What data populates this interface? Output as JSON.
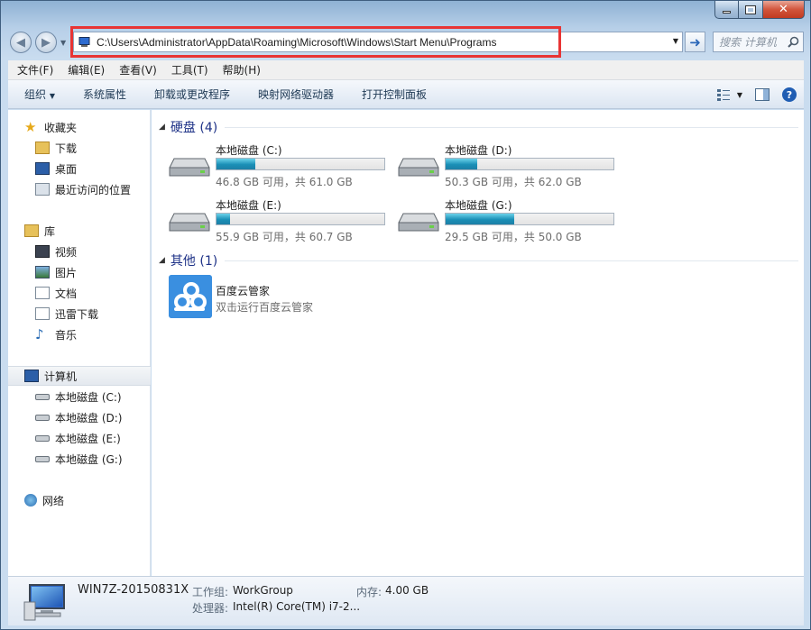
{
  "window": {
    "address_path": "C:\\Users\\Administrator\\AppData\\Roaming\\Microsoft\\Windows\\Start Menu\\Programs",
    "search_placeholder": "搜索 计算机"
  },
  "menu": [
    "文件(F)",
    "编辑(E)",
    "查看(V)",
    "工具(T)",
    "帮助(H)"
  ],
  "commands": [
    "组织",
    "系统属性",
    "卸载或更改程序",
    "映射网络驱动器",
    "打开控制面板"
  ],
  "sidebar": {
    "favorites": {
      "label": "收藏夹",
      "items": [
        "下载",
        "桌面",
        "最近访问的位置"
      ]
    },
    "libraries": {
      "label": "库",
      "items": [
        "视频",
        "图片",
        "文档",
        "迅雷下载",
        "音乐"
      ]
    },
    "computer": {
      "label": "计算机",
      "items": [
        "本地磁盘 (C:)",
        "本地磁盘 (D:)",
        "本地磁盘 (E:)",
        "本地磁盘 (G:)"
      ]
    },
    "network": {
      "label": "网络"
    }
  },
  "groups": {
    "drives_title": "硬盘 (4)",
    "other_title": "其他 (1)"
  },
  "drives": [
    {
      "name": "本地磁盘 (C:)",
      "info": "46.8 GB 可用，共 61.0 GB",
      "used_fraction": 0.233
    },
    {
      "name": "本地磁盘 (D:)",
      "info": "50.3 GB 可用，共 62.0 GB",
      "used_fraction": 0.189
    },
    {
      "name": "本地磁盘 (E:)",
      "info": "55.9 GB 可用，共 60.7 GB",
      "used_fraction": 0.079
    },
    {
      "name": "本地磁盘 (G:)",
      "info": "29.5 GB 可用，共 50.0 GB",
      "used_fraction": 0.41
    }
  ],
  "other_app": {
    "name": "百度云管家",
    "subtitle": "双击运行百度云管家"
  },
  "details": {
    "computer_name": "WIN7Z-20150831X",
    "workgroup_label": "工作组:",
    "workgroup_value": "WorkGroup",
    "memory_label": "内存:",
    "memory_value": "4.00 GB",
    "cpu_label": "处理器:",
    "cpu_value": "Intel(R) Core(TM) i7-2..."
  },
  "colors": {
    "highlight_box": "#e83434",
    "drive_bar": "#1a8fb6",
    "group_title": "#1e3287"
  }
}
